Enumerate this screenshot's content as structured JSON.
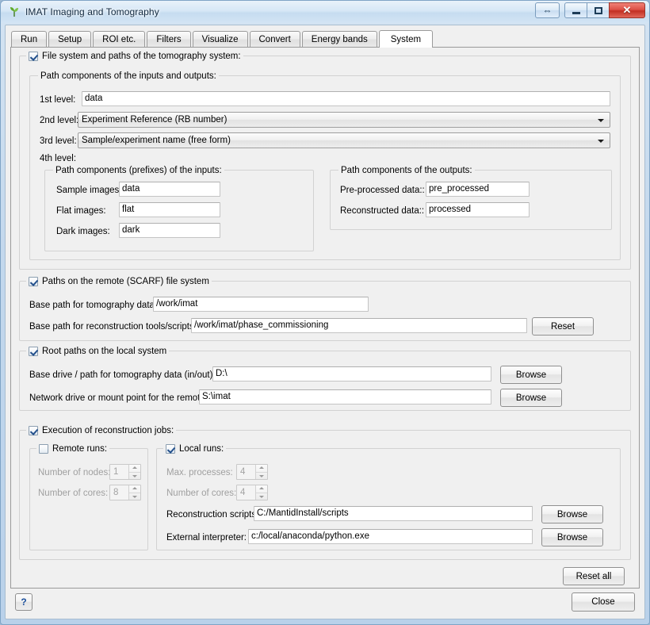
{
  "window": {
    "title": "IMAT Imaging and Tomography",
    "icon": "plant-sprout-icon",
    "controls": {
      "resize": "⇔",
      "minimize": "minimize-icon",
      "maximize": "maximize-icon",
      "close": "✕"
    }
  },
  "tabs": [
    {
      "label": "Run",
      "selected": false
    },
    {
      "label": "Setup",
      "selected": false
    },
    {
      "label": "ROI etc.",
      "selected": false
    },
    {
      "label": "Filters",
      "selected": false
    },
    {
      "label": "Visualize",
      "selected": false
    },
    {
      "label": "Convert",
      "selected": false
    },
    {
      "label": "Energy bands",
      "selected": false
    },
    {
      "label": "System",
      "selected": true
    }
  ],
  "filesystem_group": {
    "title": "File system and paths of the tomography system:",
    "checked": true,
    "path_components_group": {
      "title": "Path components of the inputs and outputs:",
      "level1": {
        "label": "1st level:",
        "value": "data"
      },
      "level2": {
        "label": "2nd level:",
        "value": "Experiment Reference (RB number)"
      },
      "level3": {
        "label": "3rd level:",
        "value": "Sample/experiment name (free form)"
      },
      "level4": {
        "label": "4th level:"
      },
      "inputs_group": {
        "title": "Path components (prefixes) of the inputs:",
        "rows": [
          {
            "label": "Sample images",
            "value": "data"
          },
          {
            "label": "Flat images:",
            "value": "flat"
          },
          {
            "label": "Dark images:",
            "value": "dark"
          }
        ]
      },
      "outputs_group": {
        "title": "Path components of the outputs:",
        "rows": [
          {
            "label": "Pre-processed data::",
            "value": "pre_processed"
          },
          {
            "label": "Reconstructed data::",
            "value": "processed"
          }
        ]
      }
    }
  },
  "remote_group": {
    "title": "Paths on the remote (SCARF) file system",
    "checked": true,
    "rows": [
      {
        "label": "Base path for tomography data:",
        "value": "/work/imat"
      },
      {
        "label": "Base path for reconstruction tools/scripts:",
        "value": "/work/imat/phase_commissioning"
      }
    ],
    "reset_label": "Reset"
  },
  "local_group": {
    "title": "Root paths on the local system",
    "checked": true,
    "rows": [
      {
        "label": "Base drive / path for tomography data (in/out)::",
        "value": "D:\\",
        "browse_label": "Browse"
      },
      {
        "label": "Network drive or mount point for the remote:",
        "value": "S:\\imat",
        "browse_label": "Browse"
      }
    ]
  },
  "execution_group": {
    "title": "Execution of reconstruction jobs:",
    "checked": true,
    "remote_runs": {
      "title": "Remote runs:",
      "checked": false,
      "enabled": false,
      "rows": [
        {
          "label": "Number of nodes:",
          "value": "1"
        },
        {
          "label": "Number of cores:",
          "value": "8"
        }
      ]
    },
    "local_runs": {
      "title": "Local runs:",
      "checked": true,
      "spinners": [
        {
          "label": "Max. processes:",
          "value": "4"
        },
        {
          "label": "Number of cores:",
          "value": "4"
        }
      ],
      "paths": [
        {
          "label": "Reconstruction scripts:",
          "value": "C:/MantidInstall/scripts",
          "browse_label": "Browse"
        },
        {
          "label": "External interpreter:",
          "value": "c:/local/anaconda/python.exe",
          "browse_label": "Browse"
        }
      ]
    }
  },
  "reset_all_label": "Reset all",
  "footer": {
    "help_label": "?",
    "close_label": "Close"
  },
  "colors": {
    "accent_blue": "#23508c",
    "close_red": "#c22f23",
    "window_bg": "#f0f0f0",
    "help_blue": "#1b4f9c"
  }
}
